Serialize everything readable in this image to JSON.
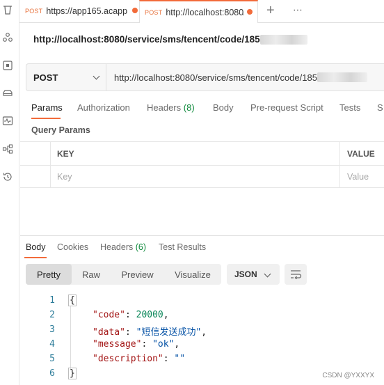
{
  "tabs": [
    {
      "method": "POST",
      "url": "https://app165.acapp",
      "unsaved": true
    },
    {
      "method": "POST",
      "url": "http://localhost:8080/",
      "unsaved": true,
      "active": true
    }
  ],
  "tab_actions": {
    "new_tab": "+",
    "more": "⋯"
  },
  "request": {
    "title_url": "http://localhost:8080/service/sms/tencent/code/185",
    "method": "POST",
    "url": "http://localhost:8080/service/sms/tencent/code/185"
  },
  "request_tabs": [
    {
      "label": "Params",
      "count": "",
      "active": true
    },
    {
      "label": "Authorization",
      "count": ""
    },
    {
      "label": "Headers",
      "count": "(8)"
    },
    {
      "label": "Body",
      "count": ""
    },
    {
      "label": "Pre-request Script",
      "count": ""
    },
    {
      "label": "Tests",
      "count": ""
    },
    {
      "label": "S",
      "count": ""
    }
  ],
  "query_params": {
    "title": "Query Params",
    "headers": [
      "KEY",
      "VALUE"
    ],
    "placeholders": {
      "key": "Key",
      "value": "Value"
    }
  },
  "response_tabs": [
    {
      "label": "Body",
      "count": "",
      "active": true
    },
    {
      "label": "Cookies",
      "count": ""
    },
    {
      "label": "Headers",
      "count": "(6)"
    },
    {
      "label": "Test Results",
      "count": ""
    }
  ],
  "format_buttons": [
    "Pretty",
    "Raw",
    "Preview",
    "Visualize"
  ],
  "format_selected": "Pretty",
  "language": "JSON",
  "response_lines": [
    {
      "n": "1",
      "text": "{"
    },
    {
      "n": "2",
      "key": "\"code\"",
      "value": "20000",
      "type": "number",
      "comma": true
    },
    {
      "n": "3",
      "key": "\"data\"",
      "value": "\"短信发送成功\"",
      "type": "string",
      "comma": true
    },
    {
      "n": "4",
      "key": "\"message\"",
      "value": "\"ok\"",
      "type": "string",
      "comma": true
    },
    {
      "n": "5",
      "key": "\"description\"",
      "value": "\"\"",
      "type": "string",
      "comma": false
    },
    {
      "n": "6",
      "text": "}"
    }
  ],
  "watermark": "CSDN @YXXYX",
  "colors": {
    "accent": "#f26b3a",
    "method": "#e8723c",
    "count": "#0f8a3c",
    "line_numbers": "#2e7d9a"
  },
  "icons": [
    "trash-icon",
    "collections-icon",
    "api-icon",
    "environments-icon",
    "monitors-icon",
    "flows-icon",
    "history-icon",
    "wrap-lines-icon",
    "chevron-down-icon"
  ]
}
